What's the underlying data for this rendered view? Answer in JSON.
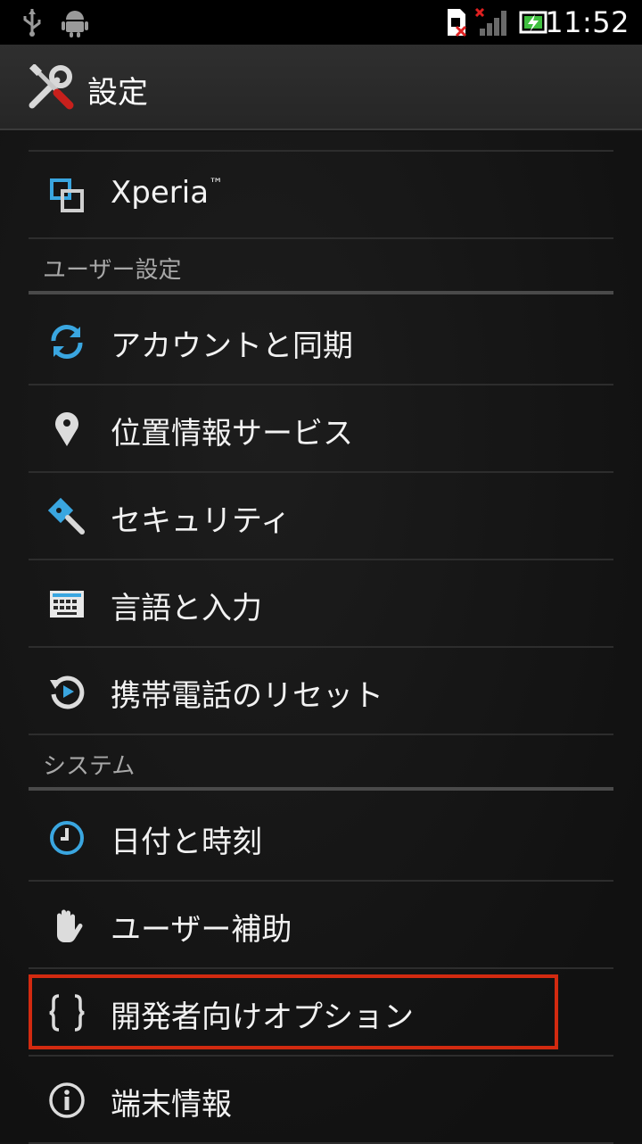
{
  "status_bar": {
    "time": "11:52",
    "icons": [
      "usb-icon",
      "android-debug-icon",
      "sim-missing-icon",
      "no-signal-icon",
      "battery-charging-icon"
    ]
  },
  "action_bar": {
    "title": "設定",
    "icon": "settings-tools-icon"
  },
  "items": {
    "xperia": {
      "label": "Xperia",
      "tm": "™",
      "icon": "xperia-icon"
    },
    "user_settings_header": "ユーザー設定",
    "accounts": {
      "label": "アカウントと同期",
      "icon": "sync-icon"
    },
    "location": {
      "label": "位置情報サービス",
      "icon": "location-pin-icon"
    },
    "security": {
      "label": "セキュリティ",
      "icon": "key-icon"
    },
    "language": {
      "label": "言語と入力",
      "icon": "keyboard-icon"
    },
    "reset": {
      "label": "携帯電話のリセット",
      "icon": "reset-icon"
    },
    "system_header": "システム",
    "datetime": {
      "label": "日付と時刻",
      "icon": "clock-icon"
    },
    "accessibility": {
      "label": "ユーザー補助",
      "icon": "hand-icon"
    },
    "developer": {
      "label": "開発者向けオプション",
      "icon": "braces-icon"
    },
    "about": {
      "label": "端末情報",
      "icon": "info-icon"
    }
  },
  "colors": {
    "accent_blue": "#3aa6e0",
    "highlight_red": "#d22a10"
  }
}
